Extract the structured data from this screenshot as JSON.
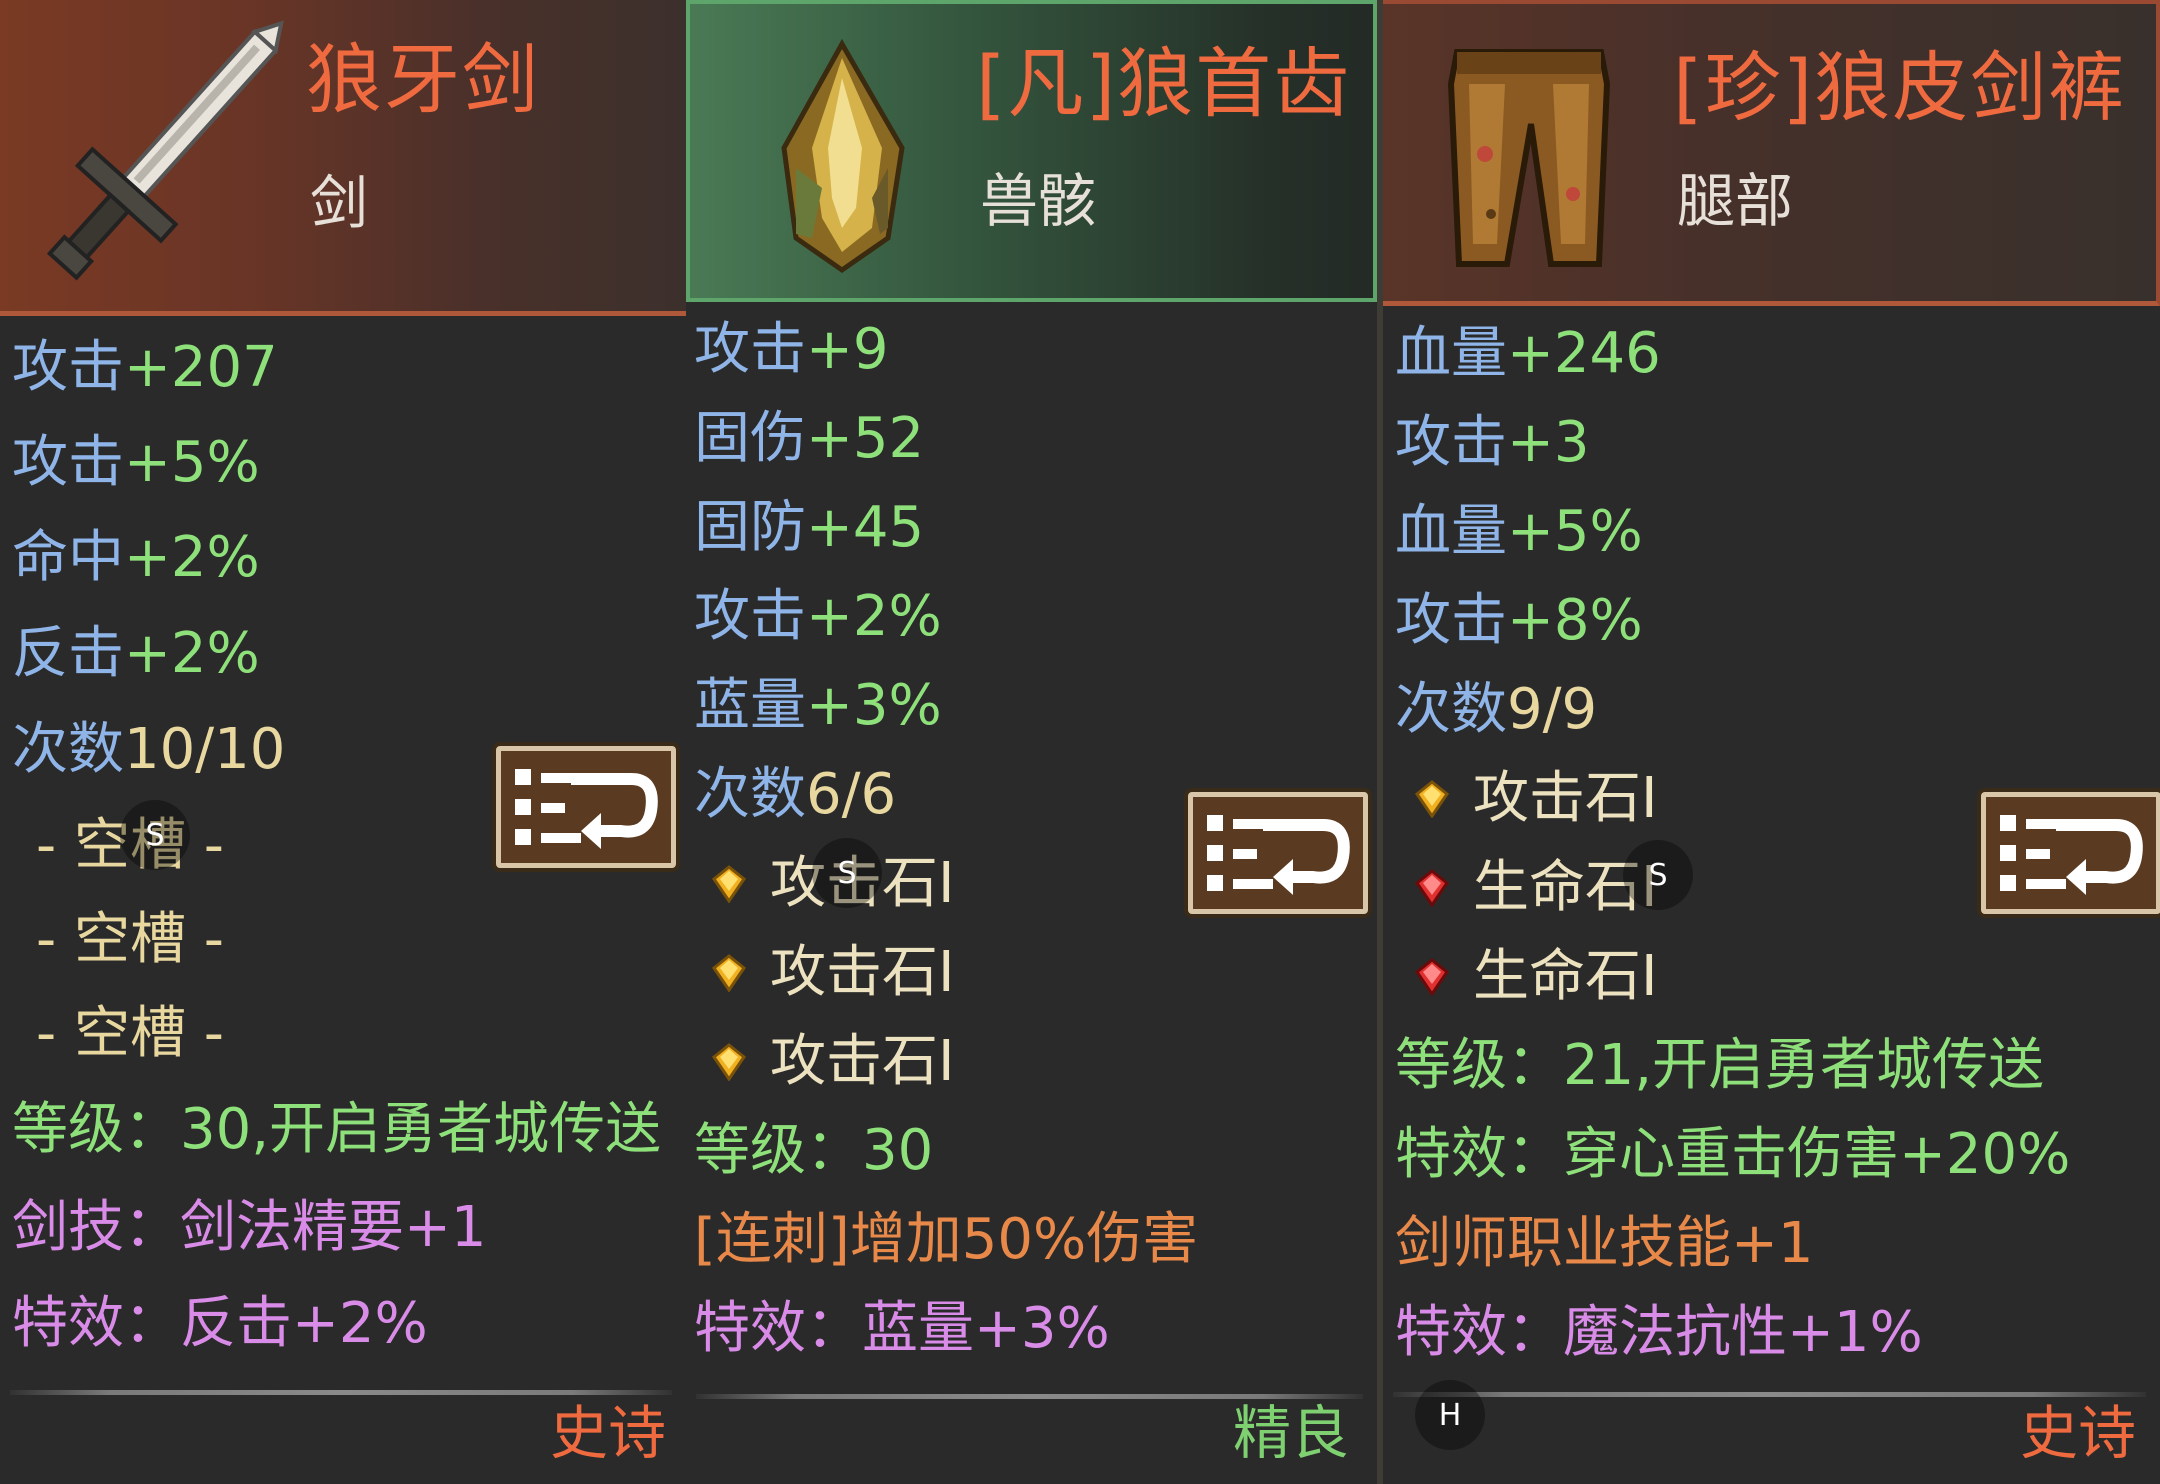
{
  "cards": [
    {
      "title": "狼牙剑",
      "type": "剑",
      "stats": [
        {
          "label": "攻击",
          "value": "+207"
        },
        {
          "label": "攻击",
          "value": "+5%"
        },
        {
          "label": "命中",
          "value": "+2%"
        },
        {
          "label": "反击",
          "value": "+2%"
        }
      ],
      "count": {
        "label": "次数",
        "value": "10/10"
      },
      "slots": [
        "- 空槽 -",
        "- 空槽 -",
        "- 空槽 -"
      ],
      "level": "等级：30,开启勇者城传送",
      "skill": "剑技：剑法精要+1",
      "effect": "特效：反击+2%",
      "rarity": "史诗",
      "overlay": "S"
    },
    {
      "title": "[凡]狼首齿",
      "type": "兽骸",
      "stats": [
        {
          "label": "攻击",
          "value": "+9"
        },
        {
          "label": "固伤",
          "value": "+52"
        },
        {
          "label": "固防",
          "value": "+45"
        },
        {
          "label": "攻击",
          "value": "+2%"
        },
        {
          "label": "蓝量",
          "value": "+3%"
        }
      ],
      "count": {
        "label": "次数",
        "value": "6/6"
      },
      "gems": [
        {
          "name": "攻击石I",
          "color": "#f0b020"
        },
        {
          "name": "攻击石I",
          "color": "#f0b020"
        },
        {
          "name": "攻击石I",
          "color": "#f0b020"
        }
      ],
      "level": "等级：30",
      "special": "[连刺]增加50%伤害",
      "effect": "特效：蓝量+3%",
      "rarity": "精良",
      "overlay": "S"
    },
    {
      "title": "[珍]狼皮剑裤",
      "type": "腿部",
      "stats": [
        {
          "label": "血量",
          "value": "+246"
        },
        {
          "label": "攻击",
          "value": "+3"
        },
        {
          "label": "血量",
          "value": "+5%"
        },
        {
          "label": "攻击",
          "value": "+8%"
        }
      ],
      "count": {
        "label": "次数",
        "value": "9/9"
      },
      "gems": [
        {
          "name": "攻击石I",
          "color": "#f0b020"
        },
        {
          "name": "生命石I",
          "color": "#e03030"
        },
        {
          "name": "生命石I",
          "color": "#e03030"
        }
      ],
      "level": "等级：21,开启勇者城传送",
      "special_effect": "特效：穿心重击伤害+20%",
      "class_skill": "剑师职业技能+1",
      "effect": "特效：魔法抗性+1%",
      "rarity": "史诗",
      "overlay": "S",
      "overlay_h": "H"
    }
  ],
  "icons": {
    "sword": "sword-icon",
    "fang": "wolf-fang-icon",
    "pants": "leather-pants-icon",
    "action": "equip-swap-icon"
  }
}
